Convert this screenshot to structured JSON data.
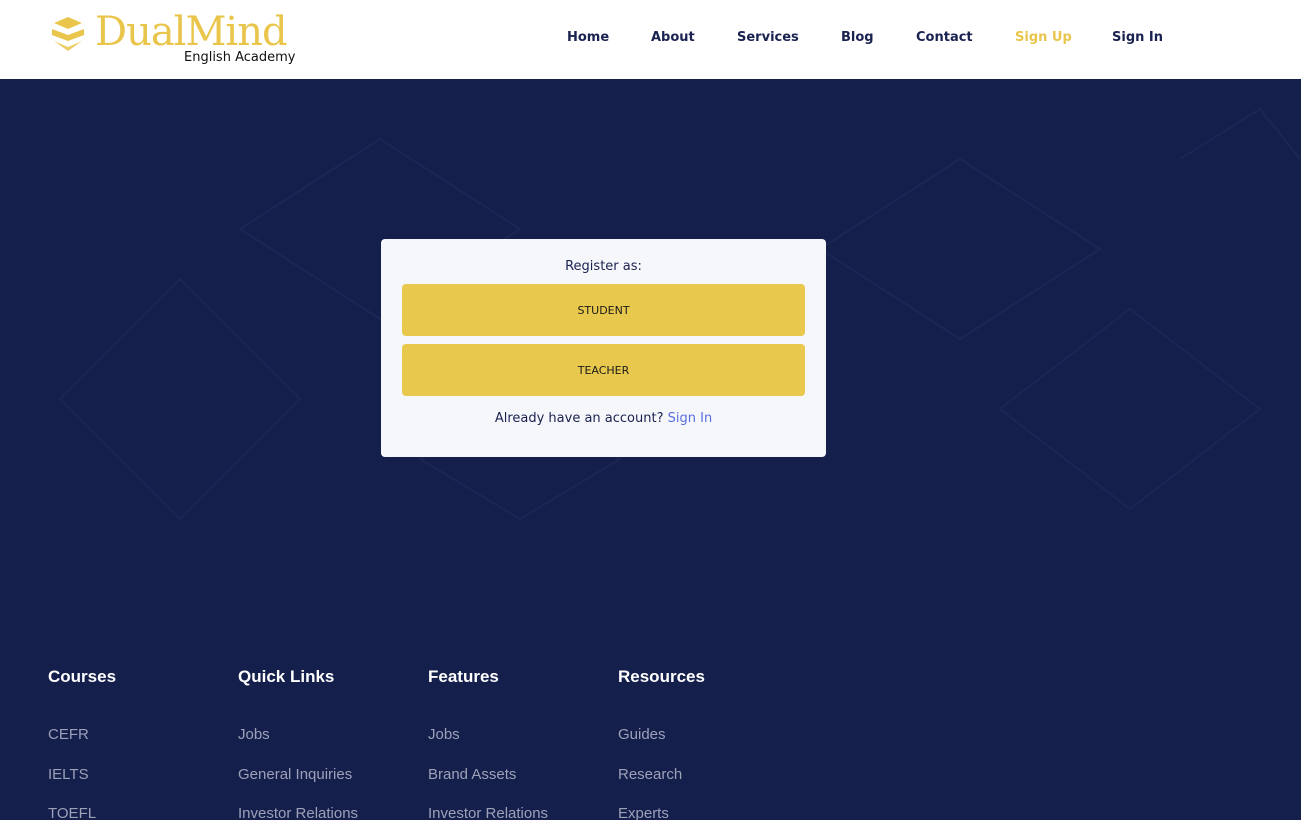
{
  "brand": {
    "name": "DualMind",
    "tagline": "English Academy",
    "color": "#e9c64b"
  },
  "nav": {
    "items": [
      {
        "label": "Home"
      },
      {
        "label": "About"
      },
      {
        "label": "Services"
      },
      {
        "label": "Blog"
      },
      {
        "label": "Contact"
      },
      {
        "label": "Sign Up",
        "active": true
      },
      {
        "label": "Sign In"
      }
    ]
  },
  "register": {
    "title": "Register as:",
    "student_label": "STUDENT",
    "teacher_label": "TEACHER",
    "footer_text": "Already have an account?",
    "signin_link": "Sign In"
  },
  "footer": {
    "columns": [
      {
        "title": "Courses",
        "links": [
          "CEFR",
          "IELTS",
          "TOEFL"
        ]
      },
      {
        "title": "Quick Links",
        "links": [
          "Jobs",
          "General Inquiries",
          "Investor Relations"
        ]
      },
      {
        "title": "Features",
        "links": [
          "Jobs",
          "Brand Assets",
          "Investor Relations"
        ]
      },
      {
        "title": "Resources",
        "links": [
          "Guides",
          "Research",
          "Experts"
        ]
      }
    ]
  },
  "colors": {
    "background": "#151f4c",
    "accent": "#e9c94d",
    "link": "#5b6ee1"
  }
}
